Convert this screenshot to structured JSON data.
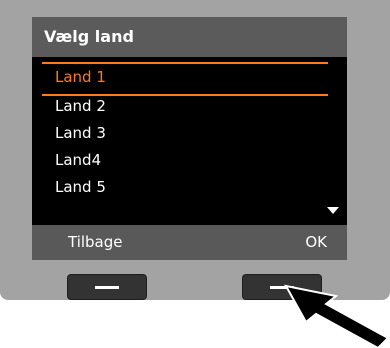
{
  "screen": {
    "title": "Vælg land",
    "items": [
      {
        "label": "Land 1",
        "selected": true
      },
      {
        "label": "Land 2",
        "selected": false
      },
      {
        "label": "Land 3",
        "selected": false
      },
      {
        "label": "Land4",
        "selected": false
      },
      {
        "label": "Land 5",
        "selected": false
      }
    ],
    "scroll_icon": "down-triangle"
  },
  "softkeys": {
    "left_label": "Tilbage",
    "right_label": "OK"
  },
  "colors": {
    "highlight": "#ff7a1a",
    "device": "#a3a3a4",
    "screen_bg": "#000000",
    "bar_bg": "#5b5b5b"
  }
}
